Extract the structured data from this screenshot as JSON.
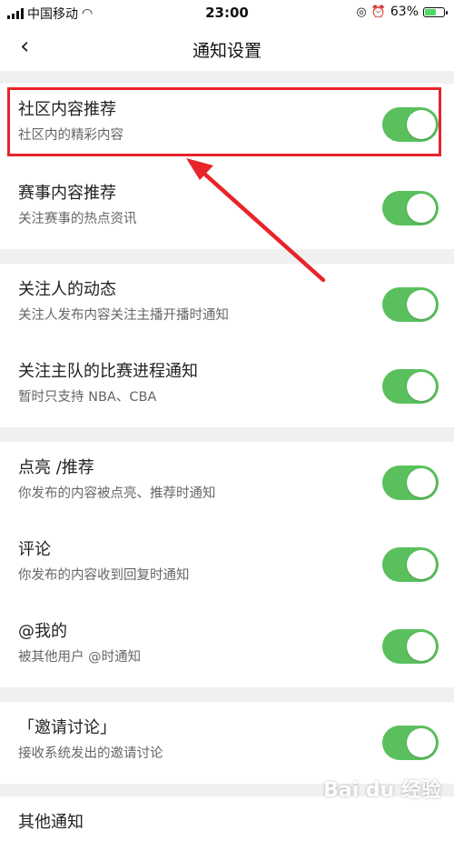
{
  "status": {
    "carrier": "中国移动",
    "time": "23:00",
    "battery_text": "63%",
    "battery_level": 0.63
  },
  "nav": {
    "back_icon": "chevron-left-icon",
    "title": "通知设置"
  },
  "settings": [
    {
      "title": "社区内容推荐",
      "desc": "社区内的精彩内容",
      "enabled": true
    },
    {
      "title": "赛事内容推荐",
      "desc": "关注赛事的热点资讯",
      "enabled": true
    },
    {
      "title": "关注人的动态",
      "desc": "关注人发布内容关注主播开播时通知",
      "enabled": true
    },
    {
      "title": "关注主队的比赛进程通知",
      "desc": "暂时只支持 NBA、CBA",
      "enabled": true
    },
    {
      "title": "点亮 /推荐",
      "desc": "你发布的内容被点亮、推荐时通知",
      "enabled": true
    },
    {
      "title": "评论",
      "desc": "你发布的内容收到回复时通知",
      "enabled": true
    },
    {
      "title": "@我的",
      "desc": "被其他用户 @时通知",
      "enabled": true
    },
    {
      "title": "「邀请讨论」",
      "desc": "接收系统发出的邀请讨论",
      "enabled": true
    },
    {
      "title": "其他通知",
      "desc": "",
      "enabled": true
    }
  ],
  "colors": {
    "toggle_on": "#5ac05d",
    "highlight": "#e8242b",
    "section_gap": "#f0f0f0"
  },
  "watermark": "Bai du 经验"
}
